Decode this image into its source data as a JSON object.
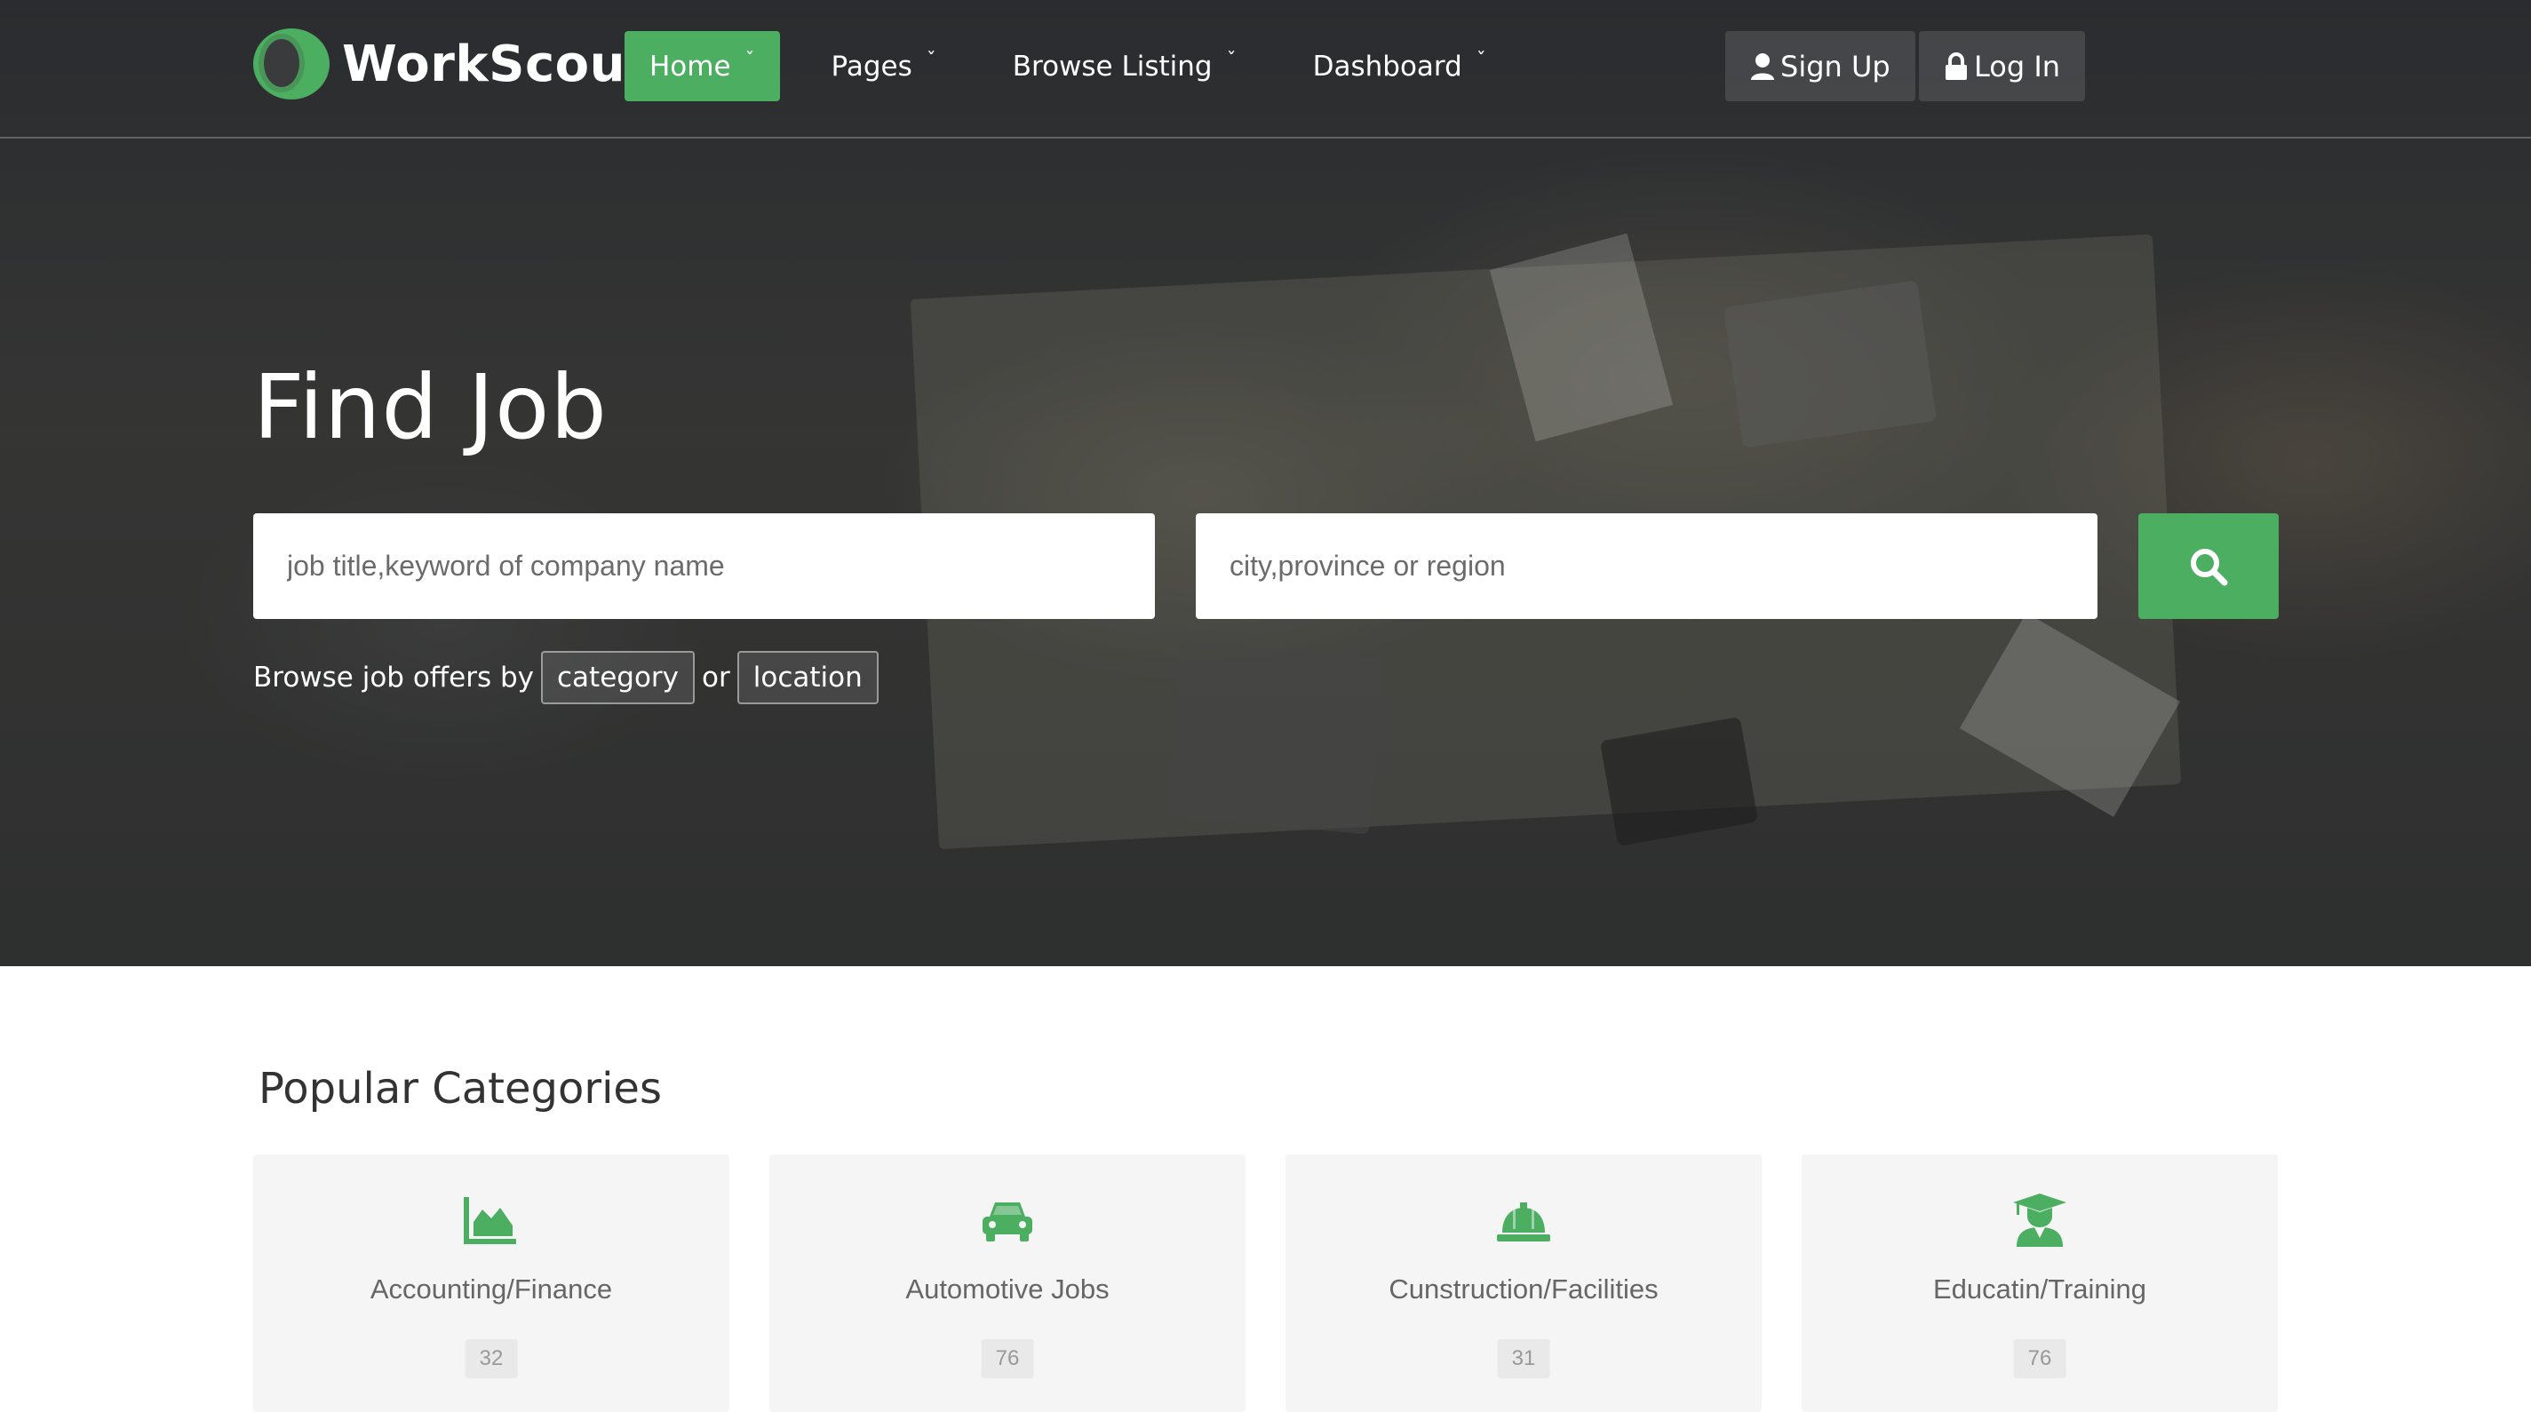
{
  "brand": {
    "name": "WorkScout",
    "accent": "#4cae61"
  },
  "nav": {
    "items": [
      {
        "label": "Home",
        "active": true
      },
      {
        "label": "Pages",
        "active": false
      },
      {
        "label": "Browse Listing",
        "active": false
      },
      {
        "label": "Dashboard",
        "active": false
      }
    ],
    "signup_label": "Sign Up",
    "login_label": "Log In",
    "chevron_icon": "chevron-down-icon"
  },
  "hero": {
    "title": "Find Job",
    "keyword_placeholder": "job title,keyword of company name",
    "location_placeholder": "city,province or region",
    "search_icon": "search-icon",
    "browse_prefix": "Browse job offers by",
    "browse_category": "category",
    "browse_or": "or",
    "browse_location": "location"
  },
  "categories": {
    "title": "Popular Categories",
    "items": [
      {
        "name": "Accounting/Finance",
        "count": "32",
        "icon": "area-chart-icon"
      },
      {
        "name": "Automotive Jobs",
        "count": "76",
        "icon": "car-icon"
      },
      {
        "name": "Cunstruction/Facilities",
        "count": "31",
        "icon": "hard-hat-icon"
      },
      {
        "name": "Educatin/Training",
        "count": "76",
        "icon": "graduate-icon"
      }
    ]
  }
}
